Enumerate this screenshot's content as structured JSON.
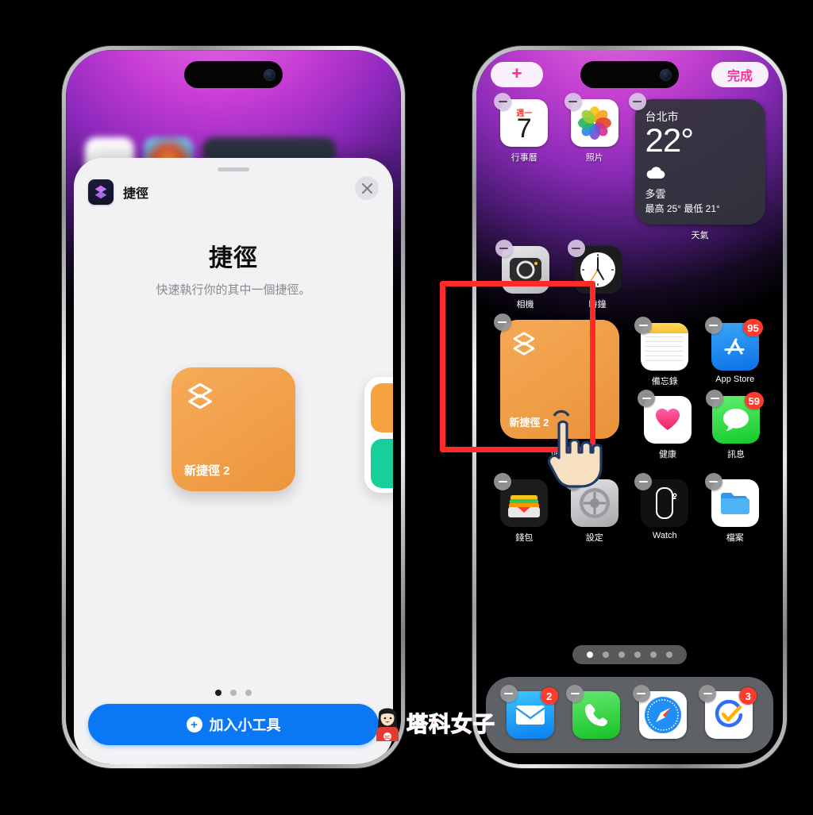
{
  "scene": {
    "description": "iOS widget picker sheet and home screen in jiggle edit mode",
    "watermark": "塔科女子",
    "highlight_color": "#ff2b2b"
  },
  "left_phone": {
    "sheet": {
      "app_icon": "shortcuts-icon",
      "app_name": "捷徑",
      "close_label": "✕",
      "title": "捷徑",
      "subtitle": "快速執行你的其中一個捷徑。",
      "widget_preview": {
        "icon": "shortcuts-layers-icon",
        "name": "新捷徑 2",
        "color": "#f2a14b"
      },
      "page_dots": {
        "total": 3,
        "active": 1
      },
      "add_button": {
        "label": "加入小工具",
        "icon": "plus-circle-icon",
        "color": "#0a78f5"
      }
    }
  },
  "right_phone": {
    "topbar": {
      "add_label": "+",
      "done_label": "完成",
      "accent": "#ff2d9b"
    },
    "rows": [
      {
        "items": [
          {
            "type": "app",
            "name": "行事曆",
            "icon": "calendar-icon",
            "day_of_week": "週一",
            "day_number": "7",
            "badge": null
          },
          {
            "type": "app",
            "name": "照片",
            "icon": "photos-icon",
            "badge": null
          },
          {
            "type": "widget",
            "name": "天氣",
            "icon": "weather-widget",
            "city": "台北市",
            "temp": "22°",
            "condition": "多雲",
            "hi_lo": "最高 25° 最低 21°"
          }
        ]
      },
      {
        "items": [
          {
            "type": "app",
            "name": "相機",
            "icon": "camera-icon",
            "badge": null
          },
          {
            "type": "app",
            "name": "時鐘",
            "icon": "clock-icon",
            "badge": null
          }
        ]
      },
      {
        "items": [
          {
            "type": "widget",
            "name": "捷徑",
            "icon": "shortcuts-layers-icon",
            "shortcut_name": "新捷徑 2",
            "highlighted": true
          },
          {
            "type": "app",
            "name": "備忘錄",
            "icon": "notes-icon",
            "badge": null
          },
          {
            "type": "app",
            "name": "App Store",
            "icon": "appstore-icon",
            "badge": "95"
          }
        ]
      },
      {
        "items": [
          {
            "type": "app",
            "name": "健康",
            "icon": "health-icon",
            "badge": null
          },
          {
            "type": "app",
            "name": "訊息",
            "icon": "messages-icon",
            "badge": "59"
          }
        ]
      },
      {
        "items": [
          {
            "type": "app",
            "name": "錢包",
            "icon": "wallet-icon",
            "badge": null
          },
          {
            "type": "app",
            "name": "設定",
            "icon": "settings-icon",
            "badge": null
          },
          {
            "type": "app",
            "name": "Watch",
            "icon": "watch-icon",
            "badge": null
          },
          {
            "type": "app",
            "name": "檔案",
            "icon": "files-icon",
            "badge": null
          }
        ]
      }
    ],
    "page_dots": {
      "total": 6,
      "active": 1
    },
    "dock": [
      {
        "name": "郵件",
        "icon": "mail-icon",
        "badge": "2"
      },
      {
        "name": "電話",
        "icon": "phone-icon",
        "badge": null
      },
      {
        "name": "Safari",
        "icon": "safari-icon",
        "badge": null
      },
      {
        "name": "提醒事項",
        "icon": "reminders-icon",
        "badge": "3"
      }
    ]
  }
}
